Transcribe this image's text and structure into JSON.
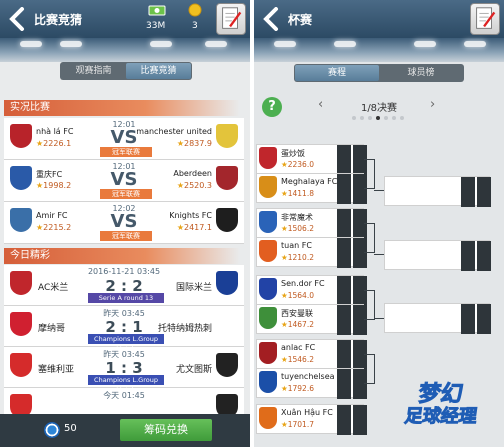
{
  "left": {
    "header": {
      "title": "比赛竞猜",
      "money": "33M",
      "coins": "3"
    },
    "tabs": [
      "观赛指南",
      "比赛竞猜"
    ],
    "live_section": "实况比赛",
    "today_section": "今日精彩",
    "live_matches": [
      {
        "time": "12:01",
        "home": "nhà lá FC",
        "home_rating": "2226.1",
        "away": "manchester united",
        "away_rating": "2837.9",
        "vs": "VS",
        "comp": "冠军联赛",
        "home_color": "#b8232a",
        "away_color": "#e3c43b"
      },
      {
        "time": "12:01",
        "home": "重庆FC",
        "home_rating": "1998.2",
        "away": "Aberdeen",
        "away_rating": "2520.3",
        "vs": "VS",
        "comp": "冠军联赛",
        "home_color": "#2a5aa8",
        "away_color": "#a3262c"
      },
      {
        "time": "12:02",
        "home": "Amir FC",
        "home_rating": "2215.2",
        "away": "Knights  FC",
        "away_rating": "2417.1",
        "vs": "VS",
        "comp": "冠军联赛",
        "home_color": "#3a6fa8",
        "away_color": "#1e1e1e"
      }
    ],
    "today_matches": [
      {
        "date": "2016-11-21  03:45",
        "home": "AC米兰",
        "away": "国际米兰",
        "score": "2 : 2",
        "league": "Serie A round 13",
        "league_color": "#5548a6",
        "home_color": "#c0262c",
        "away_color": "#1a3f96"
      },
      {
        "date": "昨天  03:45",
        "home": "摩纳哥",
        "away": "托特纳姆热刺",
        "score": "2 : 1",
        "league": "Champions L.Group Match",
        "league_color": "#3a4fb3",
        "home_color": "#d02030",
        "away_color": "#ffffff"
      },
      {
        "date": "昨天  03:45",
        "home": "塞维利亚",
        "away": "尤文图斯",
        "score": "1 : 3",
        "league": "Champions L.Group Match",
        "league_color": "#3a4fb3",
        "home_color": "#d52b2b",
        "away_color": "#222222"
      },
      {
        "date": "今天  01:45",
        "home": "",
        "away": "",
        "score": "",
        "league": "",
        "league_color": "#3a4fb3",
        "home_color": "#d52b2b",
        "away_color": "#222222"
      }
    ],
    "bottom": {
      "chips": "50",
      "redeem": "筹码兑换"
    }
  },
  "right": {
    "header": {
      "title": "杯赛"
    },
    "tabs": [
      "赛程",
      "球员榜"
    ],
    "help": "?",
    "round": "1/8决赛",
    "prev": "‹",
    "next": "›",
    "teams": [
      {
        "name": "蛋炒饭",
        "rating": "2236.0",
        "color": "#c0262c"
      },
      {
        "name": "Meghalaya FC",
        "rating": "1411.8",
        "color": "#d88e18"
      },
      {
        "name": "非常魔术",
        "rating": "1506.2",
        "color": "#2a63b8"
      },
      {
        "name": "tuan FC",
        "rating": "1210.2",
        "color": "#e25e20"
      },
      {
        "name": "Sen.dor FC",
        "rating": "1564.0",
        "color": "#2243a6"
      },
      {
        "name": "西安曼联",
        "rating": "1467.2",
        "color": "#3e8f3a"
      },
      {
        "name": "anlac FC",
        "rating": "1546.2",
        "color": "#a31e22"
      },
      {
        "name": "tuyenchelsea .",
        "rating": "1792.6",
        "color": "#1b4fa8"
      },
      {
        "name": "Xuân Hậu FC",
        "rating": "1701.7",
        "color": "#e06c1a"
      }
    ],
    "logo": {
      "line1": "梦幻",
      "line2": "足球经理"
    }
  }
}
